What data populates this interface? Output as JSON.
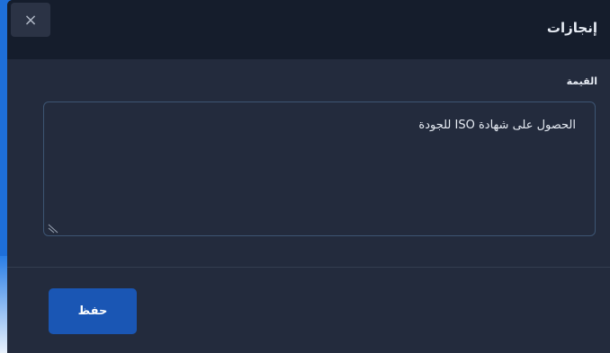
{
  "modal": {
    "title": "إنجازات",
    "close_glyph": "×"
  },
  "field": {
    "label": "القيمة",
    "value": "الحصول على شهادة ISO للجودة"
  },
  "actions": {
    "save_label": "حفظ"
  },
  "colors": {
    "modal_bg": "#232b3d",
    "header_bg": "#151d2c",
    "primary": "#1a56b4",
    "accent": "#1e6fd9"
  },
  "icons": {
    "close": "close-icon",
    "resize": "resize-handle-icon"
  }
}
